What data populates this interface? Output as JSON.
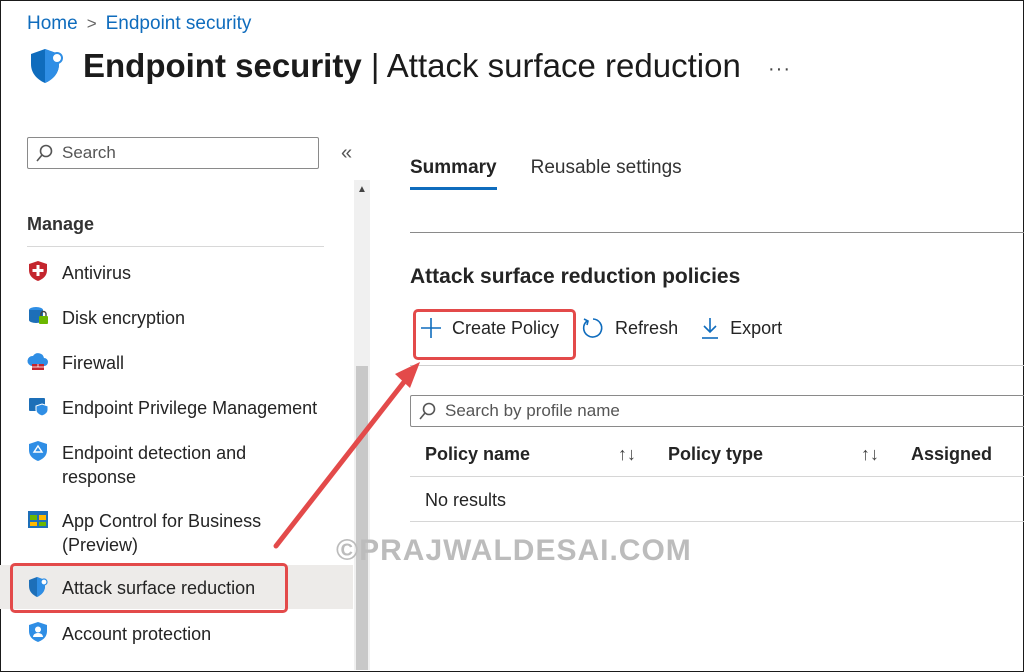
{
  "breadcrumb": {
    "home": "Home",
    "current": "Endpoint security"
  },
  "header": {
    "title_bold": "Endpoint security",
    "title_sep": " | ",
    "title_rest": "Attack surface reduction",
    "more": "···"
  },
  "sidebar": {
    "search_placeholder": "Search",
    "collapse": "«",
    "section": "Manage",
    "items": [
      {
        "label": "Antivirus",
        "icon": "antivirus-shield-icon"
      },
      {
        "label": "Disk encryption",
        "icon": "disk-encryption-icon"
      },
      {
        "label": "Firewall",
        "icon": "firewall-icon"
      },
      {
        "label": "Endpoint Privilege Management",
        "icon": "privilege-management-icon"
      },
      {
        "label_line1": "Endpoint detection and",
        "label_line2": "response",
        "icon": "edr-shield-icon"
      },
      {
        "label_line1": "App Control for Business",
        "label_line2": "(Preview)",
        "icon": "app-control-icon"
      },
      {
        "label": "Attack surface reduction",
        "icon": "asr-shield-icon",
        "selected": true
      },
      {
        "label": "Account protection",
        "icon": "account-protection-icon"
      }
    ]
  },
  "tabs": [
    {
      "label": "Summary",
      "active": true
    },
    {
      "label": "Reusable settings",
      "active": false
    }
  ],
  "main": {
    "heading": "Attack surface reduction policies",
    "toolbar": {
      "create": "Create Policy",
      "refresh": "Refresh",
      "export": "Export"
    },
    "search_placeholder": "Search by profile name",
    "columns": [
      "Policy name",
      "Policy type",
      "Assigned"
    ],
    "empty": "No results"
  },
  "watermark": "©PRAJWALDESAI.COM",
  "colors": {
    "accent": "#0f6cbd",
    "highlight": "#e34a4a",
    "selected_bg": "#edebe9"
  }
}
